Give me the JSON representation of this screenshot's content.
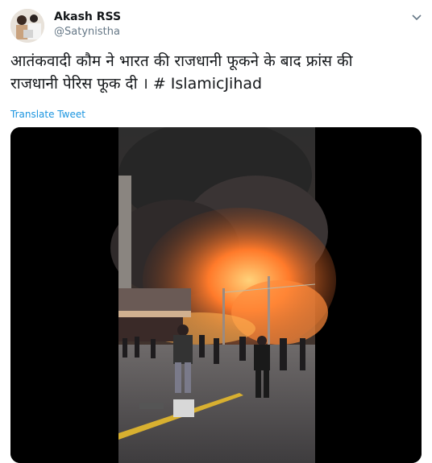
{
  "author": {
    "name": "Akash RSS",
    "handle": "@Satynistha",
    "avatar_icon": "profile-photo"
  },
  "tweet": {
    "text_line1": "आतंकवादी कौम ने भारत की राजधानी फूकने के बाद फ्रांस की",
    "text_line2": "राजधानी पेरिस फूक दी । # IslamicJihad",
    "translate_label": "Translate Tweet"
  },
  "media": {
    "type": "video",
    "description_icon": "video-frame"
  },
  "colors": {
    "link": "#1b95e0",
    "text": "#14171a",
    "secondary": "#657786"
  }
}
